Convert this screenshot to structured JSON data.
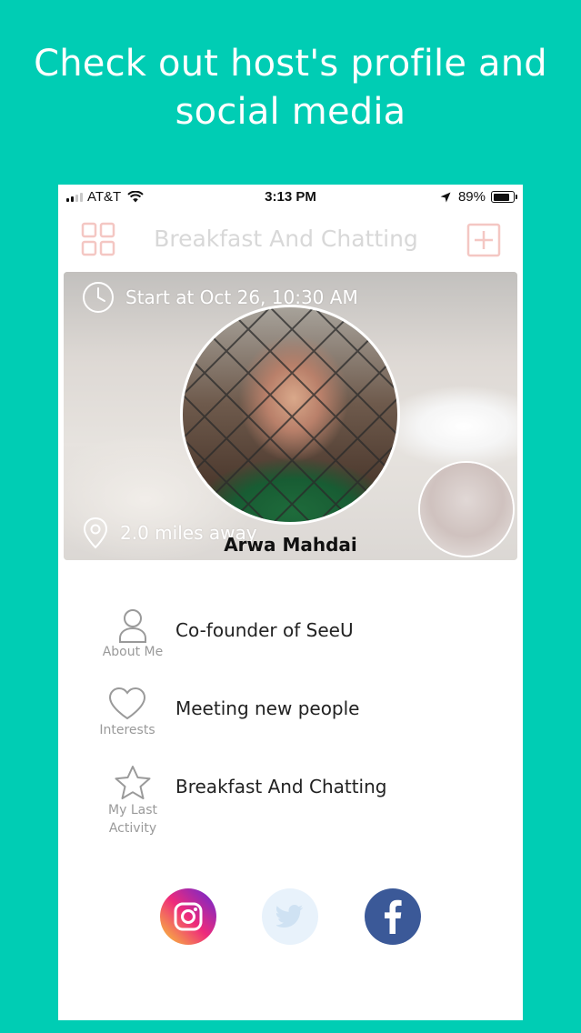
{
  "headline": {
    "line1": "Check out host's profile and",
    "line2": "social media"
  },
  "status_bar": {
    "carrier": "AT&T",
    "time": "3:13 PM",
    "battery": "89%",
    "battery_level": 0.89,
    "signal_bars": 4,
    "signal_active": 2
  },
  "nav": {
    "title": "Breakfast And Chatting",
    "left_icon": "grid-icon",
    "right_icon": "add-icon"
  },
  "event": {
    "start": "Start at Oct 26, 10:30 AM",
    "distance": "2.0 miles away",
    "host_name": "Arwa Mahdai"
  },
  "profile": {
    "items": [
      {
        "icon": "person-icon",
        "label": "About Me",
        "value": "Co-founder of SeeU"
      },
      {
        "icon": "heart-icon",
        "label": "Interests",
        "value": "Meeting new people"
      },
      {
        "icon": "star-icon",
        "label_line1": "My Last",
        "label_line2": "Activity",
        "value": "Breakfast And Chatting"
      }
    ]
  },
  "social": [
    {
      "name": "instagram",
      "icon": "instagram-icon",
      "color": "#E1306C"
    },
    {
      "name": "twitter",
      "icon": "twitter-icon",
      "color": "#1DA1F2"
    },
    {
      "name": "facebook",
      "icon": "facebook-icon",
      "color": "#3B5998"
    }
  ],
  "colors": {
    "background": "#00CDB4",
    "nav_accent": "#F4C7C3",
    "title_disabled": "#D8D8D8"
  }
}
